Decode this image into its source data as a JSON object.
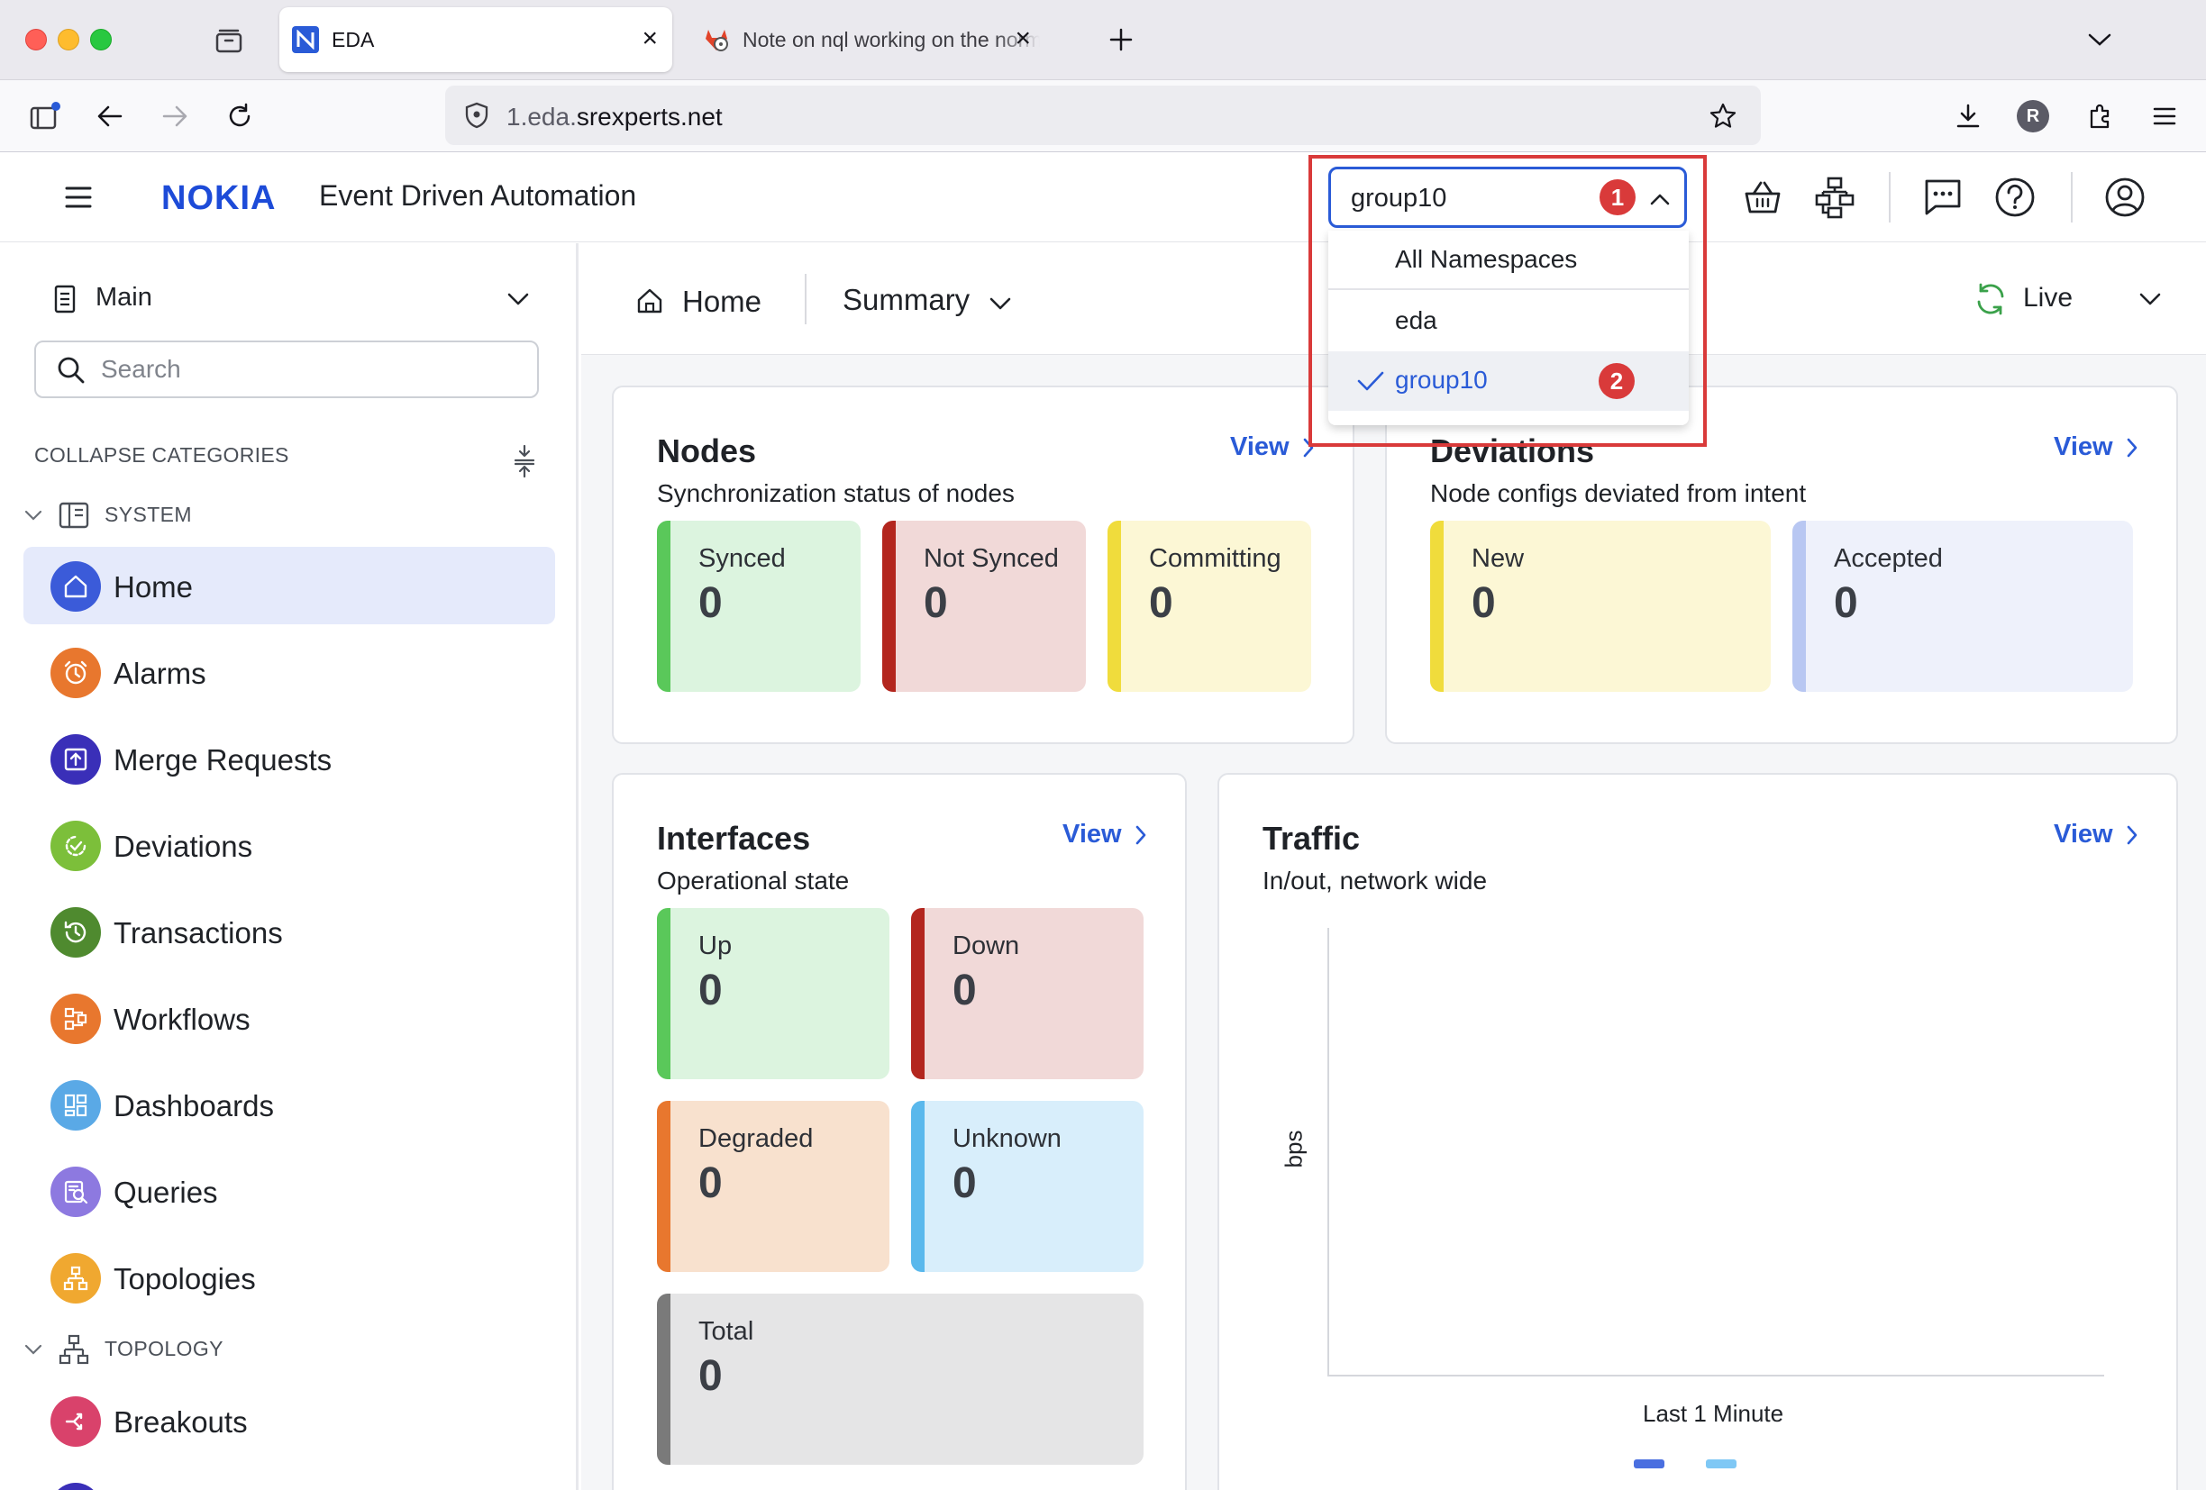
{
  "browser": {
    "tabs": [
      {
        "title": "EDA",
        "active": true
      },
      {
        "title": "Note on nql working on the normal",
        "active": false
      }
    ],
    "url_prefix": "1.eda.",
    "url_domain": "srexperts.net",
    "profile_initial": "R"
  },
  "app": {
    "brand": "NOKIA",
    "title": "Event Driven Automation",
    "namespace": {
      "selected": "group10",
      "badge1": "1",
      "badge2": "2",
      "options": [
        "All Namespaces",
        "eda",
        "group10"
      ]
    }
  },
  "sidebar": {
    "menu_selector": "Main",
    "search_placeholder": "Search",
    "collapse_label": "COLLAPSE CATEGORIES",
    "categories": {
      "system": "SYSTEM",
      "topology": "TOPOLOGY"
    },
    "items": [
      {
        "label": "Home",
        "color": "#3b5bd9"
      },
      {
        "label": "Alarms",
        "color": "#e8772e"
      },
      {
        "label": "Merge Requests",
        "color": "#3a2fb8"
      },
      {
        "label": "Deviations",
        "color": "#7cbf3a"
      },
      {
        "label": "Transactions",
        "color": "#4f8a2f"
      },
      {
        "label": "Workflows",
        "color": "#e8772e"
      },
      {
        "label": "Dashboards",
        "color": "#5aa9e6"
      },
      {
        "label": "Queries",
        "color": "#8d79e0"
      },
      {
        "label": "Topologies",
        "color": "#f0a830"
      },
      {
        "label": "Breakouts",
        "color": "#d9426b"
      }
    ]
  },
  "main": {
    "breadcrumb_home": "Home",
    "view_selector": "Summary",
    "live_label": "Live",
    "view_link": "View",
    "nodes": {
      "title": "Nodes",
      "subtitle": "Synchronization status of nodes",
      "stats": [
        {
          "label": "Synced",
          "value": "0"
        },
        {
          "label": "Not Synced",
          "value": "0"
        },
        {
          "label": "Committing",
          "value": "0"
        }
      ]
    },
    "deviations": {
      "title": "Deviations",
      "subtitle": "Node configs deviated from intent",
      "stats": [
        {
          "label": "New",
          "value": "0"
        },
        {
          "label": "Accepted",
          "value": "0"
        }
      ]
    },
    "interfaces": {
      "title": "Interfaces",
      "subtitle": "Operational state",
      "stats": [
        {
          "label": "Up",
          "value": "0"
        },
        {
          "label": "Down",
          "value": "0"
        },
        {
          "label": "Degraded",
          "value": "0"
        },
        {
          "label": "Unknown",
          "value": "0"
        },
        {
          "label": "Total",
          "value": "0"
        }
      ]
    },
    "traffic": {
      "title": "Traffic",
      "subtitle": "In/out, network wide",
      "ylabel": "bps",
      "xlabel": "Last 1 Minute"
    }
  },
  "colors": {
    "accent": "#2a5bd7",
    "annotation": "#d93a3a",
    "synced": "#5ac85a",
    "not_synced": "#b3261e",
    "committing": "#f0dc3c",
    "accepted": "#b8c7f2",
    "degraded": "#e8772e",
    "unknown": "#5ab8ec",
    "total": "#7a7a7a"
  }
}
